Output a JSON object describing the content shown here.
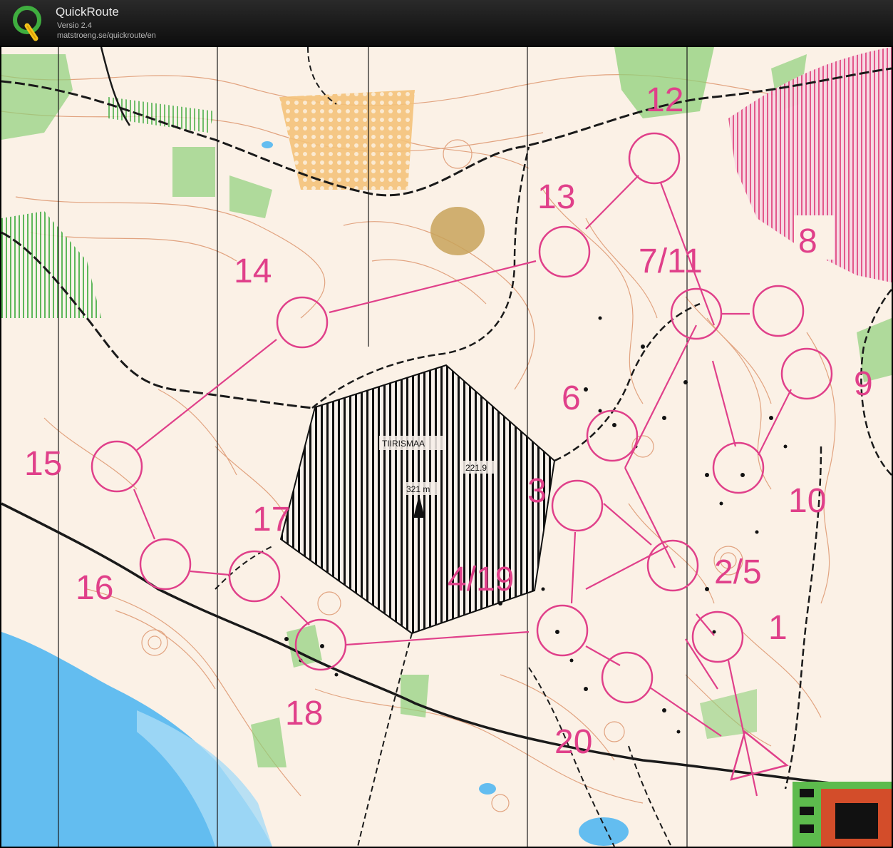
{
  "app": {
    "name": "QuickRoute",
    "version": "Versio 2.4",
    "url": "matstroeng.se/quickroute/en",
    "logo_letter": "Q"
  },
  "map": {
    "place_name": "TIIRISMAA",
    "elevation_label": "321 m",
    "spot_height": "221.9",
    "colors": {
      "course": "#e0408a",
      "contour": "#d98a5e",
      "vegetation": "#7cc46a",
      "water": "#66bff0",
      "track": "#1a1a1a"
    },
    "control_labels": [
      "1",
      "2/5",
      "3",
      "4/19",
      "6",
      "7/11",
      "8",
      "9",
      "10",
      "12",
      "13",
      "14",
      "15",
      "16",
      "17",
      "18",
      "20"
    ]
  }
}
